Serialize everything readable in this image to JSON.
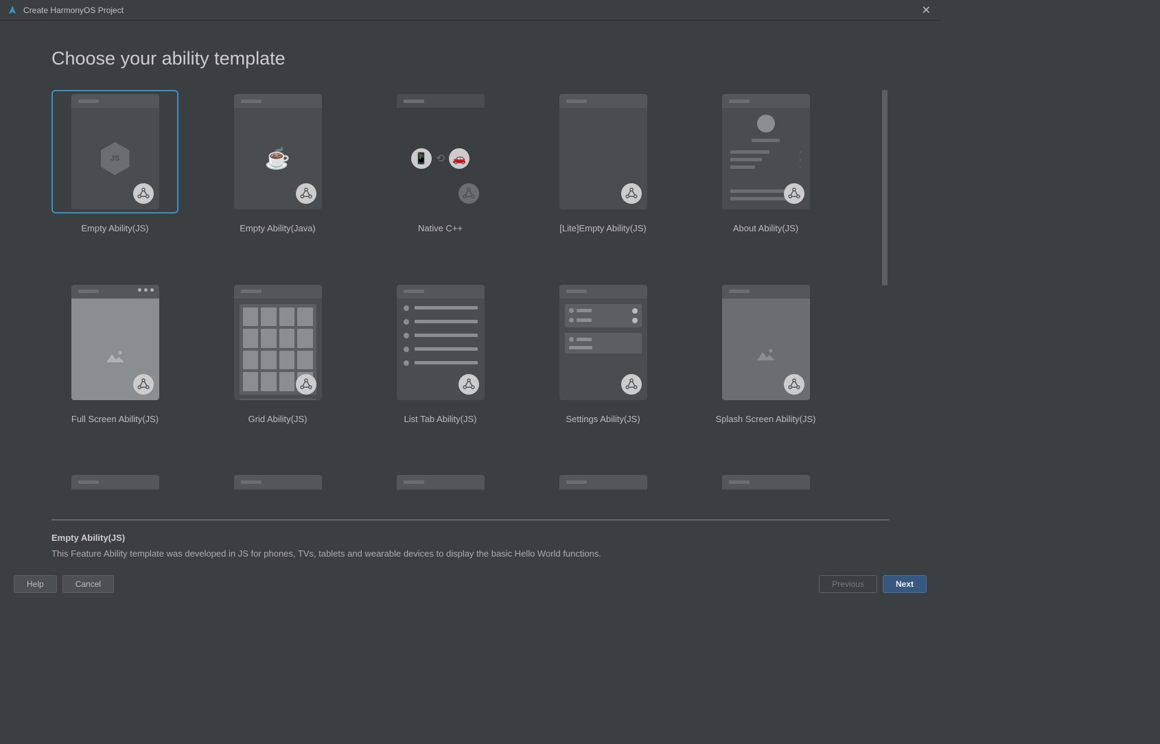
{
  "window": {
    "title": "Create HarmonyOS Project"
  },
  "page": {
    "title": "Choose your ability template"
  },
  "templates": [
    {
      "label": "Empty Ability(JS)",
      "selected": true
    },
    {
      "label": "Empty Ability(Java)",
      "selected": false
    },
    {
      "label": "Native C++",
      "selected": false
    },
    {
      "label": "[Lite]Empty Ability(JS)",
      "selected": false
    },
    {
      "label": "About Ability(JS)",
      "selected": false
    },
    {
      "label": "Full Screen Ability(JS)",
      "selected": false
    },
    {
      "label": "Grid Ability(JS)",
      "selected": false
    },
    {
      "label": "List Tab Ability(JS)",
      "selected": false
    },
    {
      "label": "Settings Ability(JS)",
      "selected": false
    },
    {
      "label": "Splash Screen Ability(JS)",
      "selected": false
    }
  ],
  "description": {
    "title": "Empty Ability(JS)",
    "text": "This Feature Ability template was developed in JS for phones, TVs, tablets and wearable devices to display the basic Hello World functions."
  },
  "buttons": {
    "help": "Help",
    "cancel": "Cancel",
    "previous": "Previous",
    "next": "Next"
  },
  "icons": {
    "js_text": "JS"
  }
}
